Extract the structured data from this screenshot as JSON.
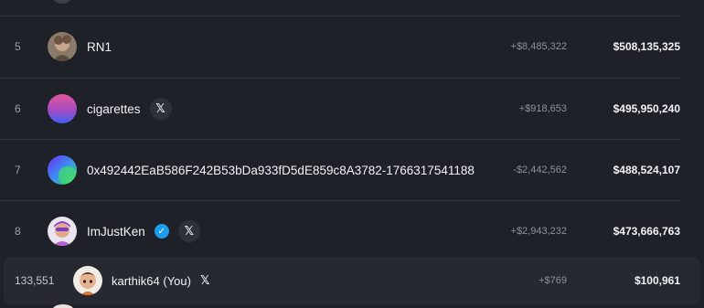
{
  "leaderboard": {
    "rows": [
      {
        "rank": "5",
        "name": "RN1",
        "pnl": "+$8,485,322",
        "volume": "$508,135,325"
      },
      {
        "rank": "6",
        "name": "cigarettes",
        "pnl": "+$918,653",
        "volume": "$495,950,240",
        "x_icon": "𝕏"
      },
      {
        "rank": "7",
        "name": "0x492442EaB586F242B53bDa933fD5dE859c8A3782-1766317541188",
        "pnl": "-$2,442,562",
        "volume": "$488,524,107"
      },
      {
        "rank": "8",
        "name": "ImJustKen",
        "pnl": "+$2,943,232",
        "volume": "$473,666,763",
        "x_icon": "𝕏",
        "verified_icon": "✓"
      }
    ],
    "current_user": {
      "rank": "133,551",
      "name": "karthik64 (You)",
      "pnl": "+$769",
      "volume": "$100,961",
      "x_icon": "𝕏"
    }
  },
  "colors": {
    "background": "#1e2127",
    "divider": "#30343b",
    "highlight_row": "#262a30",
    "verified": "#1d9bf0",
    "text_primary": "#f1f3f5",
    "text_muted": "#8b929c"
  }
}
